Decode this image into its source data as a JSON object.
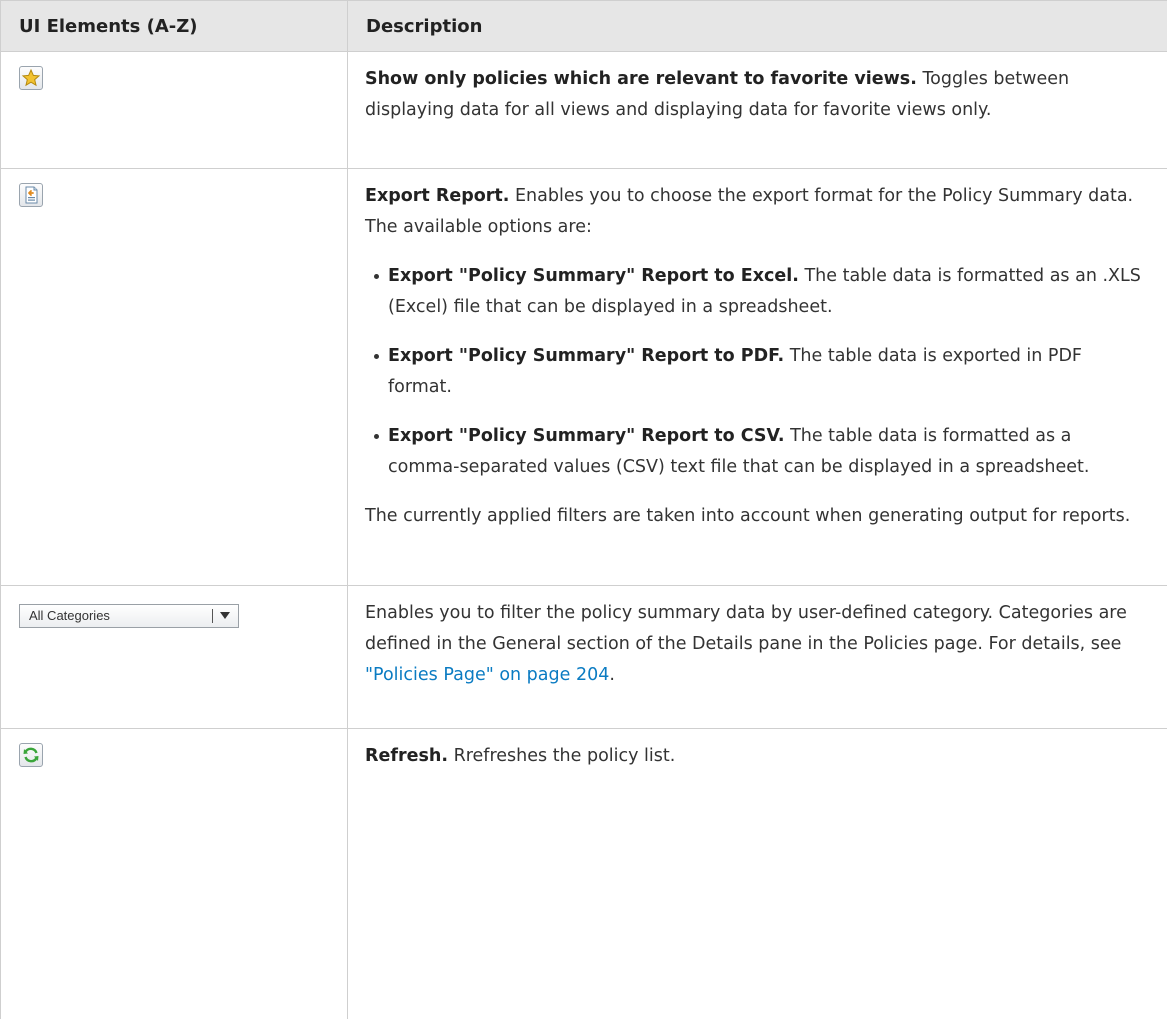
{
  "table": {
    "headers": [
      "UI Elements (A-Z)",
      "Description"
    ],
    "rows": [
      {
        "element_icon": "favorite-star-icon",
        "title": "Show only policies which are relevant to favorite views.",
        "text": "Toggles between displaying data for all views and displaying data for favorite views only."
      },
      {
        "element_icon": "export-report-icon",
        "title": "Export Report.",
        "text": "Enables you to choose the export format for the Policy Summary data. The available options are:",
        "options": [
          {
            "title": "Export \"Policy Summary\" Report to Excel.",
            "text": "The table data is formatted as an .XLS (Excel) file that can be displayed in a spreadsheet."
          },
          {
            "title": "Export \"Policy Summary\" Report to PDF.",
            "text": "The table data is exported in PDF format."
          },
          {
            "title": "Export \"Policy Summary\" Report to CSV.",
            "text": "The table data is formatted as a comma-separated values (CSV) text file that can be displayed in a spreadsheet."
          }
        ],
        "note": "The currently applied filters are taken into account when generating output for reports."
      },
      {
        "element_dropdown": "All Categories",
        "text": "Enables you to filter the policy summary data by user-defined category. Categories are defined in the General section of the Details pane in the Policies page. For details, see",
        "link": "\"Policies Page\" on page 204",
        "text_end": "."
      },
      {
        "element_icon": "refresh-icon",
        "title": "Refresh.",
        "text": "Rrefreshes the policy list."
      }
    ]
  },
  "colors": {
    "header_bg": "#e6e6e6",
    "border": "#cfcfcf",
    "link": "#0a7bc2",
    "refresh_green": "#3aa53a",
    "star_gold": "#f2c230"
  }
}
